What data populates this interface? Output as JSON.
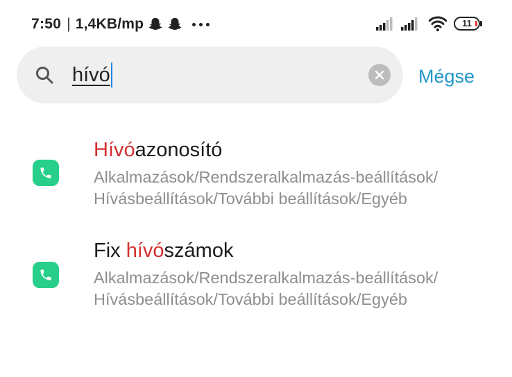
{
  "status_bar": {
    "time": "7:50",
    "separator": "|",
    "net_speed": "1,4KB/mp",
    "battery_level": "11",
    "notification_icons": [
      "snapchat-ghost-icon",
      "snapchat-ghost-icon",
      "more-dots-icon"
    ],
    "system_icons": [
      "signal-icon",
      "signal-icon",
      "wifi-icon",
      "battery-icon"
    ]
  },
  "search": {
    "query": "hívó",
    "cancel_label": "Mégse"
  },
  "results": [
    {
      "icon": "phone-icon",
      "title_prefix": "",
      "title_match": "Hívó",
      "title_suffix": "azonosító",
      "path_line1": "Alkalmazások/Rendszeralkalmazás-beállítások/",
      "path_line2": "Hívásbeállítások/További beállítások/Egyéb"
    },
    {
      "icon": "phone-icon",
      "title_prefix": "Fix ",
      "title_match": "hívó",
      "title_suffix": "számok",
      "path_line1": "Alkalmazások/Rendszeralkalmazás-beállítások/",
      "path_line2": "Hívásbeállítások/További beállítások/Egyéb"
    }
  ],
  "colors": {
    "accent": "#2196c8",
    "highlight": "#d32f2f",
    "app_icon_green": "#27cf8a",
    "battery_low": "#e53935"
  }
}
